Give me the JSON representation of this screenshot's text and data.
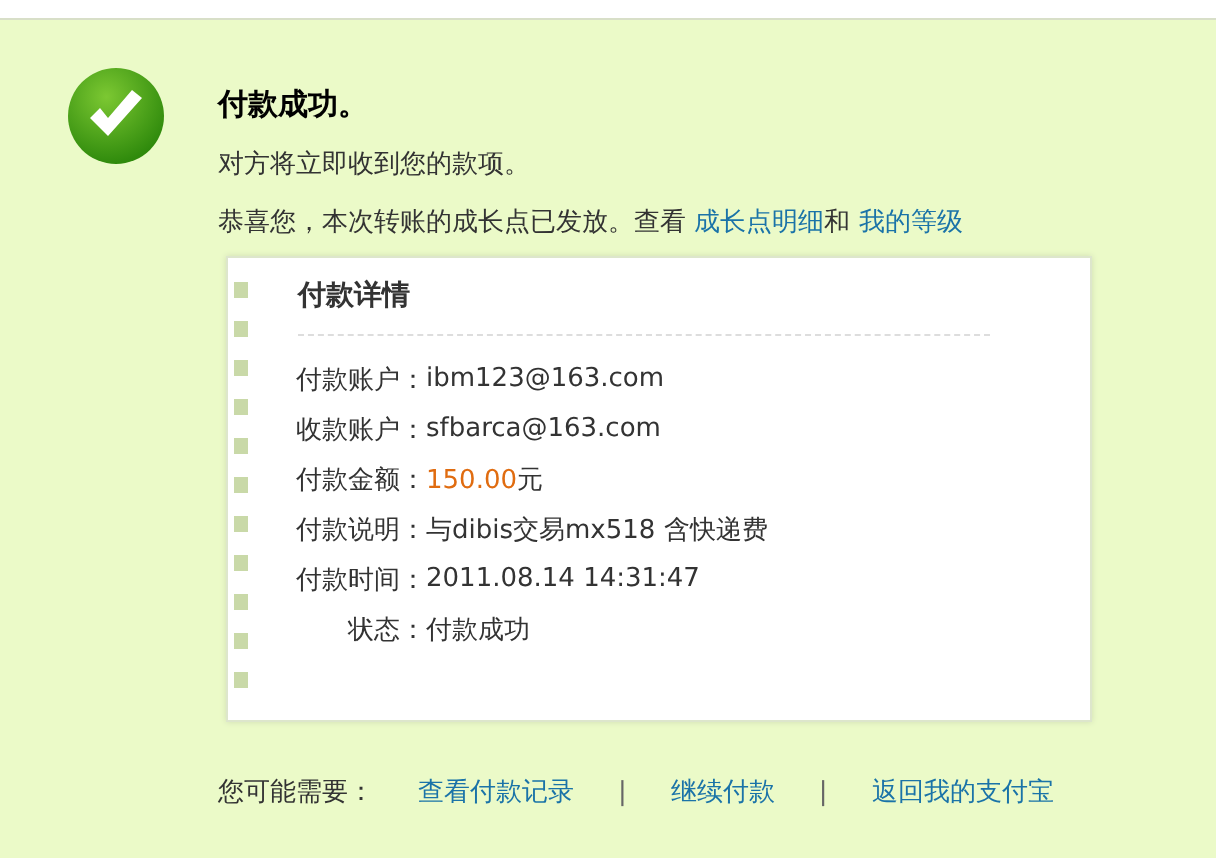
{
  "status": {
    "title": "付款成功。",
    "message": "对方将立即收到您的款项。",
    "notice": [
      {
        "kind": "text",
        "text": "恭喜您，本次转账的成长点已发放。查看 "
      },
      {
        "kind": "link",
        "text": "成长点明细"
      },
      {
        "kind": "text",
        "text": "和 "
      },
      {
        "kind": "link",
        "text": "我的等级"
      }
    ]
  },
  "details": {
    "title": "付款详情",
    "rows": [
      {
        "label": "付款账户：",
        "value": "ibm123@163.com",
        "kind": "text"
      },
      {
        "label": "收款账户：",
        "value": "sfbarca@163.com",
        "kind": "text"
      },
      {
        "label": "付款金额：",
        "value": "150.00",
        "unit": "元",
        "kind": "amount"
      },
      {
        "label": "付款说明：",
        "value": "与dibis交易mx518 含快递费",
        "kind": "text"
      },
      {
        "label": "付款时间：",
        "value": "2011.08.14 14:31:47",
        "kind": "text"
      },
      {
        "label": "状态：",
        "value": "付款成功",
        "kind": "text"
      }
    ]
  },
  "footer": {
    "label": "您可能需要：",
    "links": [
      "查看付款记录",
      "继续付款",
      "返回我的支付宝"
    ],
    "separator": "|"
  }
}
